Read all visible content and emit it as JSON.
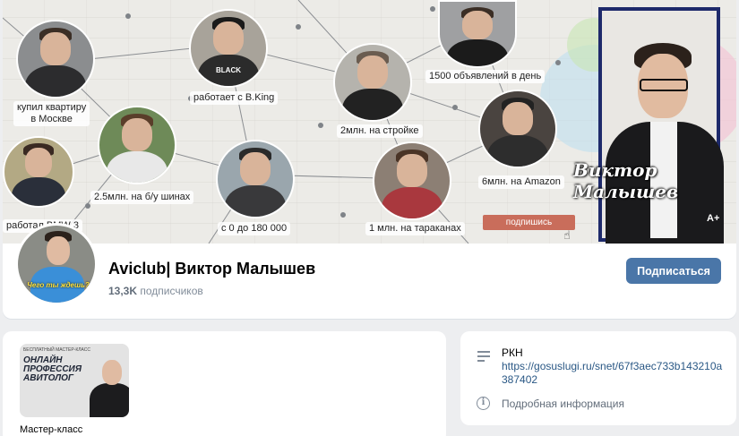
{
  "cover": {
    "captions": {
      "c1": "купил квартиру\nв Москве",
      "c2": "работает с B.King",
      "c3": "2млн. на стройке",
      "c4": "1500 объявлений  в день",
      "c5": "2.5млн. на б/у шинах",
      "c6": "6млн. на Amazon",
      "c7": "работал   BMW 3",
      "c8": "с 0 до 180 000",
      "c9": "1 млн. на тараканах"
    },
    "badge_text": "BLACK",
    "host_name": "Виктор\nМалышев",
    "subscribe_pill": "подпишись",
    "age_rating": "A+"
  },
  "profile": {
    "name": "Aviclub| Виктор Малышев",
    "subscribers_count": "13,3K",
    "subscribers_label": "подписчиков",
    "avatar_tagline": "Чего ты ждешь?",
    "subscribe_button": "Подписаться"
  },
  "left_card": {
    "thumb_small": "БЕСПЛАТНЫЙ МАСТЕР-КЛАСС",
    "thumb_title": "ОНЛАЙН ПРОФЕССИЯ АВИТОЛОГ",
    "label": "Мастер-класс"
  },
  "right_card": {
    "rkn_title": "РКН",
    "rkn_link": "https://gosuslugi.ru/snet/67f3aec733b143210a387402",
    "details": "Подробная информация"
  }
}
